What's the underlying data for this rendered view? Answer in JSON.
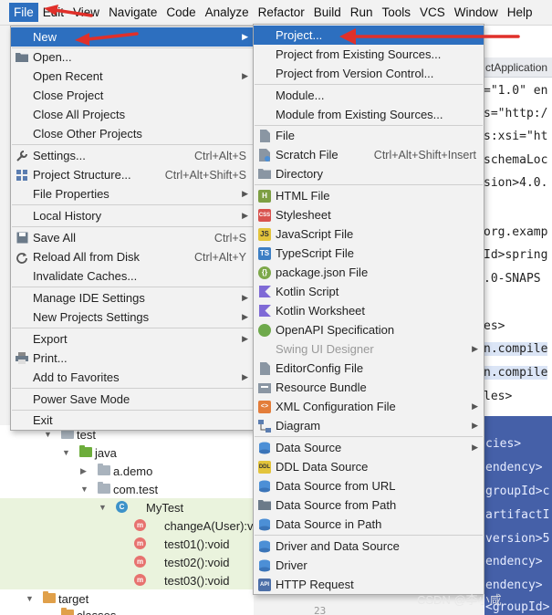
{
  "menubar": {
    "items": [
      "File",
      "Edit",
      "View",
      "Navigate",
      "Code",
      "Analyze",
      "Refactor",
      "Build",
      "Run",
      "Tools",
      "VCS",
      "Window",
      "Help"
    ]
  },
  "editor": {
    "tab_label": "ctApplication",
    "lines": [
      "=\"1.0\" en",
      "s=\"http:/",
      "s:xsi=\"ht",
      "schemaLoc",
      "sion>4.0.",
      "",
      "org.examp",
      "Id>spring",
      ".0-SNAPS",
      "",
      "es>",
      "n.compile",
      "n.compile",
      "les>"
    ],
    "xml_lines": [
      "cies>",
      "endency>",
      "groupId>c",
      "artifactI",
      "version>5",
      "endency>",
      "endency>",
      "<groupId>"
    ],
    "gutter_number": "23"
  },
  "tree": {
    "rows": [
      {
        "label": "test",
        "kind": "folder"
      },
      {
        "label": "java",
        "kind": "folder-green"
      },
      {
        "label": "a.demo",
        "kind": "folder"
      },
      {
        "label": "com.test",
        "kind": "folder"
      },
      {
        "label": "MyTest",
        "kind": "class"
      },
      {
        "label": "changeA(User):vo",
        "kind": "method"
      },
      {
        "label": "test01():void",
        "kind": "method"
      },
      {
        "label": "test02():void",
        "kind": "method"
      },
      {
        "label": "test03():void",
        "kind": "method"
      },
      {
        "label": "target",
        "kind": "folder-orange"
      },
      {
        "label": "classes",
        "kind": "folder-orange"
      }
    ]
  },
  "file_menu": {
    "items": [
      {
        "label": "New",
        "shortcut": "",
        "submenu": true,
        "icon": ""
      },
      {
        "label": "Open...",
        "shortcut": "",
        "submenu": false,
        "icon": "folder-icon"
      },
      {
        "label": "Open Recent",
        "shortcut": "",
        "submenu": true,
        "icon": ""
      },
      {
        "label": "Close Project",
        "shortcut": "",
        "submenu": false,
        "icon": ""
      },
      {
        "label": "Close All Projects",
        "shortcut": "",
        "submenu": false,
        "icon": ""
      },
      {
        "label": "Close Other Projects",
        "shortcut": "",
        "submenu": false,
        "icon": ""
      },
      {
        "label": "Settings...",
        "shortcut": "Ctrl+Alt+S",
        "submenu": false,
        "icon": "wrench-icon"
      },
      {
        "label": "Project Structure...",
        "shortcut": "Ctrl+Alt+Shift+S",
        "submenu": false,
        "icon": "project-structure-icon"
      },
      {
        "label": "File Properties",
        "shortcut": "",
        "submenu": true,
        "icon": ""
      },
      {
        "label": "Local History",
        "shortcut": "",
        "submenu": true,
        "icon": ""
      },
      {
        "label": "Save All",
        "shortcut": "Ctrl+S",
        "submenu": false,
        "icon": "save-icon"
      },
      {
        "label": "Reload All from Disk",
        "shortcut": "Ctrl+Alt+Y",
        "submenu": false,
        "icon": "reload-icon"
      },
      {
        "label": "Invalidate Caches...",
        "shortcut": "",
        "submenu": false,
        "icon": ""
      },
      {
        "label": "Manage IDE Settings",
        "shortcut": "",
        "submenu": true,
        "icon": ""
      },
      {
        "label": "New Projects Settings",
        "shortcut": "",
        "submenu": true,
        "icon": ""
      },
      {
        "label": "Export",
        "shortcut": "",
        "submenu": true,
        "icon": ""
      },
      {
        "label": "Print...",
        "shortcut": "",
        "submenu": false,
        "icon": "print-icon"
      },
      {
        "label": "Add to Favorites",
        "shortcut": "",
        "submenu": true,
        "icon": ""
      },
      {
        "label": "Power Save Mode",
        "shortcut": "",
        "submenu": false,
        "icon": ""
      },
      {
        "label": "Exit",
        "shortcut": "",
        "submenu": false,
        "icon": ""
      }
    ]
  },
  "new_menu": {
    "items": [
      {
        "label": "Project...",
        "shortcut": "",
        "submenu": false,
        "icon": "",
        "disabled": false
      },
      {
        "label": "Project from Existing Sources...",
        "shortcut": "",
        "submenu": false,
        "icon": "",
        "disabled": false
      },
      {
        "label": "Project from Version Control...",
        "shortcut": "",
        "submenu": false,
        "icon": "",
        "disabled": false
      },
      {
        "label": "Module...",
        "shortcut": "",
        "submenu": false,
        "icon": "",
        "disabled": false
      },
      {
        "label": "Module from Existing Sources...",
        "shortcut": "",
        "submenu": false,
        "icon": "",
        "disabled": false
      },
      {
        "label": "File",
        "shortcut": "",
        "submenu": false,
        "icon": "file-icon",
        "disabled": false
      },
      {
        "label": "Scratch File",
        "shortcut": "Ctrl+Alt+Shift+Insert",
        "submenu": false,
        "icon": "scratch-file-icon",
        "disabled": false
      },
      {
        "label": "Directory",
        "shortcut": "",
        "submenu": false,
        "icon": "directory-icon",
        "disabled": false
      },
      {
        "label": "HTML File",
        "shortcut": "",
        "submenu": false,
        "icon": "html-icon",
        "disabled": false
      },
      {
        "label": "Stylesheet",
        "shortcut": "",
        "submenu": false,
        "icon": "css-icon",
        "disabled": false
      },
      {
        "label": "JavaScript File",
        "shortcut": "",
        "submenu": false,
        "icon": "js-icon",
        "disabled": false
      },
      {
        "label": "TypeScript File",
        "shortcut": "",
        "submenu": false,
        "icon": "ts-icon",
        "disabled": false
      },
      {
        "label": "package.json File",
        "shortcut": "",
        "submenu": false,
        "icon": "package-json-icon",
        "disabled": false
      },
      {
        "label": "Kotlin Script",
        "shortcut": "",
        "submenu": false,
        "icon": "kotlin-icon",
        "disabled": false
      },
      {
        "label": "Kotlin Worksheet",
        "shortcut": "",
        "submenu": false,
        "icon": "kotlin-icon",
        "disabled": false
      },
      {
        "label": "OpenAPI Specification",
        "shortcut": "",
        "submenu": false,
        "icon": "openapi-icon",
        "disabled": false
      },
      {
        "label": "Swing UI Designer",
        "shortcut": "",
        "submenu": true,
        "icon": "",
        "disabled": true
      },
      {
        "label": "EditorConfig File",
        "shortcut": "",
        "submenu": false,
        "icon": "editorconfig-icon",
        "disabled": false
      },
      {
        "label": "Resource Bundle",
        "shortcut": "",
        "submenu": false,
        "icon": "resource-bundle-icon",
        "disabled": false
      },
      {
        "label": "XML Configuration File",
        "shortcut": "",
        "submenu": true,
        "icon": "xml-icon",
        "disabled": false
      },
      {
        "label": "Diagram",
        "shortcut": "",
        "submenu": true,
        "icon": "diagram-icon",
        "disabled": false
      },
      {
        "label": "Data Source",
        "shortcut": "",
        "submenu": true,
        "icon": "database-icon",
        "disabled": false
      },
      {
        "label": "DDL Data Source",
        "shortcut": "",
        "submenu": false,
        "icon": "ddl-icon",
        "disabled": false
      },
      {
        "label": "Data Source from URL",
        "shortcut": "",
        "submenu": false,
        "icon": "database-icon",
        "disabled": false
      },
      {
        "label": "Data Source from Path",
        "shortcut": "",
        "submenu": false,
        "icon": "folder-icon",
        "disabled": false
      },
      {
        "label": "Data Source in Path",
        "shortcut": "",
        "submenu": false,
        "icon": "database-icon",
        "disabled": false
      },
      {
        "label": "Driver and Data Source",
        "shortcut": "",
        "submenu": false,
        "icon": "database-icon",
        "disabled": false
      },
      {
        "label": "Driver",
        "shortcut": "",
        "submenu": false,
        "icon": "database-icon",
        "disabled": false
      },
      {
        "label": "HTTP Request",
        "shortcut": "",
        "submenu": false,
        "icon": "api-icon",
        "disabled": false
      }
    ]
  },
  "watermark": "CSDN @李小咸",
  "colors": {
    "selection": "#2d6fbf",
    "menu_bg": "#f2f2f2",
    "arrow": "#e0302a"
  }
}
